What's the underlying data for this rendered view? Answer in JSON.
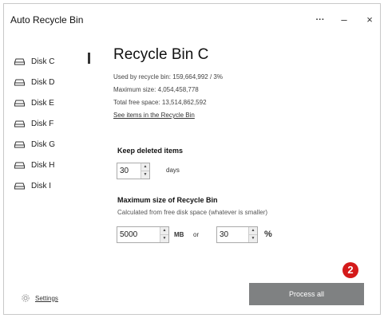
{
  "window": {
    "title": "Auto Recycle Bin",
    "more_label": "···",
    "minimize_label": "–",
    "close_label": "×"
  },
  "sidebar": {
    "items": [
      {
        "label": "Disk C",
        "icon": "drive-icon",
        "selected": true
      },
      {
        "label": "Disk D",
        "icon": "drive-icon",
        "selected": false
      },
      {
        "label": "Disk E",
        "icon": "drive-icon",
        "selected": false
      },
      {
        "label": "Disk F",
        "icon": "drive-icon",
        "selected": false
      },
      {
        "label": "Disk G",
        "icon": "drive-icon",
        "selected": false
      },
      {
        "label": "Disk H",
        "icon": "drive-icon",
        "selected": false
      },
      {
        "label": "Disk I",
        "icon": "drive-icon",
        "selected": false
      }
    ],
    "settings_label": "Settings",
    "settings_icon": "gear-icon"
  },
  "main": {
    "heading": "Recycle Bin C",
    "used": "Used by recycle bin: 159,664,992 / 3%",
    "max_size": "Maximum size: 4,054,458,778",
    "free_space": "Total free space: 13,514,862,592",
    "see_items_link": "See items in the Recycle Bin",
    "keep_title": "Keep deleted items",
    "keep_value": "30",
    "keep_unit": "days",
    "max_title": "Maximum size of Recycle Bin",
    "max_subtitle": "Calculated from free disk space (whatever is smaller)",
    "mb_value": "5000",
    "mb_unit": "MB",
    "or_label": "or",
    "pct_value": "30",
    "pct_unit": "%",
    "spin_up": "▲",
    "spin_down": "▼"
  },
  "footer": {
    "badge": "2",
    "badge_color": "#d41a1a",
    "process_label": "Process all",
    "process_color": "#7f8182"
  }
}
